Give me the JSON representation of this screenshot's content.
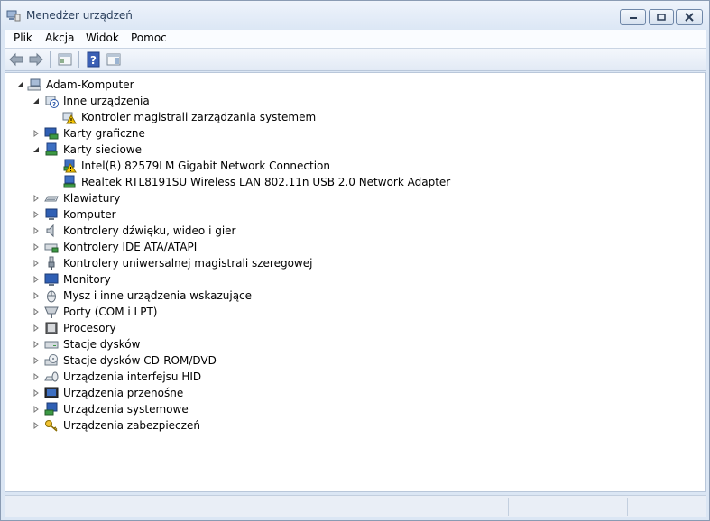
{
  "window": {
    "title": "Menedżer urządzeń",
    "controls": {
      "minimize_icon": "minimize-icon",
      "maximize_icon": "maximize-icon",
      "close_icon": "close-icon"
    }
  },
  "menu": [
    {
      "label": "Plik"
    },
    {
      "label": "Akcja"
    },
    {
      "label": "Widok"
    },
    {
      "label": "Pomoc"
    }
  ],
  "toolbar": {
    "buttons": [
      "back-arrow-icon",
      "forward-arrow-icon",
      "properties-icon",
      "help-icon",
      "action-pane-icon"
    ]
  },
  "tree": {
    "root": "Adam-Komputer",
    "items": [
      {
        "label": "Inne urządzenia",
        "icon": "unknown-device-icon",
        "expanded": true
      },
      {
        "label": "Kontroler magistrali zarządzania systemem",
        "icon": "warning-device-icon"
      },
      {
        "label": "Karty graficzne",
        "icon": "display-adapter-icon",
        "expanded": false
      },
      {
        "label": "Karty sieciowe",
        "icon": "network-adapter-icon",
        "expanded": true
      },
      {
        "label": "Intel(R) 82579LM Gigabit Network Connection",
        "icon": "network-warning-icon"
      },
      {
        "label": "Realtek RTL8191SU Wireless LAN 802.11n USB 2.0 Network Adapter",
        "icon": "network-adapter-icon"
      },
      {
        "label": "Klawiatury",
        "icon": "keyboard-icon",
        "expanded": false
      },
      {
        "label": "Komputer",
        "icon": "computer-icon",
        "expanded": false
      },
      {
        "label": "Kontrolery dźwięku, wideo i gier",
        "icon": "speaker-icon",
        "expanded": false
      },
      {
        "label": "Kontrolery IDE ATA/ATAPI",
        "icon": "ide-controller-icon",
        "expanded": false
      },
      {
        "label": "Kontrolery uniwersalnej magistrali szeregowej",
        "icon": "usb-icon",
        "expanded": false
      },
      {
        "label": "Monitory",
        "icon": "monitor-icon",
        "expanded": false
      },
      {
        "label": "Mysz i inne urządzenia wskazujące",
        "icon": "mouse-icon",
        "expanded": false
      },
      {
        "label": "Porty (COM i LPT)",
        "icon": "port-icon",
        "expanded": false
      },
      {
        "label": "Procesory",
        "icon": "processor-icon",
        "expanded": false
      },
      {
        "label": "Stacje dysków",
        "icon": "disk-drive-icon",
        "expanded": false
      },
      {
        "label": "Stacje dysków CD-ROM/DVD",
        "icon": "cdrom-icon",
        "expanded": false
      },
      {
        "label": "Urządzenia interfejsu HID",
        "icon": "hid-icon",
        "expanded": false
      },
      {
        "label": "Urządzenia przenośne",
        "icon": "portable-device-icon",
        "expanded": false
      },
      {
        "label": "Urządzenia systemowe",
        "icon": "system-device-icon",
        "expanded": false
      },
      {
        "label": "Urządzenia zabezpieczeń",
        "icon": "security-device-icon",
        "expanded": false
      }
    ]
  },
  "colors": {
    "titlebar_text": "#2a3f5c",
    "frame": "#dbe6f4",
    "warning": "#f2c200"
  }
}
